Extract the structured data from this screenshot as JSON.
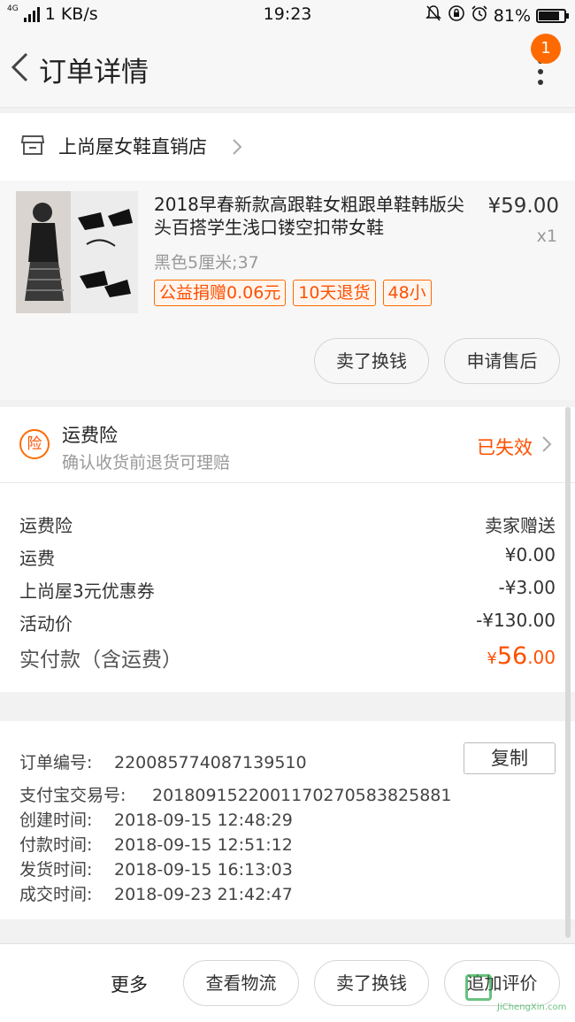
{
  "status_bar": {
    "network": "4G",
    "speed": "1 KB/s",
    "time": "19:23",
    "battery": "81%",
    "battery_level": 0.81
  },
  "nav": {
    "title": "订单详情",
    "badge_count": "1"
  },
  "shop": {
    "name": "上尚屋女鞋直销店"
  },
  "product": {
    "title": "2018早春新款高跟鞋女粗跟单鞋韩版尖头百搭学生浅口镂空扣带女鞋",
    "price": "¥59.00",
    "qty": "x1",
    "sku": "黑色5厘米;37",
    "tags": [
      "公益捐赠0.06元",
      "10天退货",
      "48小"
    ],
    "actions": [
      "卖了换钱",
      "申请售后"
    ]
  },
  "insurance": {
    "icon_text": "险",
    "title": "运费险",
    "subtitle": "确认收货前退货可理赔",
    "status": "已失效"
  },
  "fees": [
    {
      "label": "运费险",
      "value": "卖家赠送"
    },
    {
      "label": "运费",
      "value": "¥0.00"
    },
    {
      "label": "上尚屋3元优惠券",
      "value": "-¥3.00"
    },
    {
      "label": "活动价",
      "value": "-¥130.00"
    }
  ],
  "total": {
    "label": "实付款（含运费）",
    "currency": "¥",
    "integer": "56",
    "decimal": ".00"
  },
  "order_info": {
    "copy_label": "复制",
    "rows": [
      {
        "label": "订单编号:",
        "value": "220085774087139510"
      },
      {
        "label": "支付宝交易号:",
        "value": "2018091522001170270583825881"
      },
      {
        "label": "创建时间:",
        "value": "2018-09-15 12:48:29"
      },
      {
        "label": "付款时间:",
        "value": "2018-09-15 12:51:12"
      },
      {
        "label": "发货时间:",
        "value": "2018-09-15 16:13:03"
      },
      {
        "label": "成交时间:",
        "value": "2018-09-23 21:42:47"
      }
    ]
  },
  "bottom_bar": {
    "more": "更多",
    "actions": [
      "查看物流",
      "卖了换钱",
      "追加评价"
    ]
  },
  "watermark": {
    "text": "JiChengXin.com"
  },
  "colors": {
    "accent": "#ff5000",
    "badge": "#ff6a00"
  }
}
